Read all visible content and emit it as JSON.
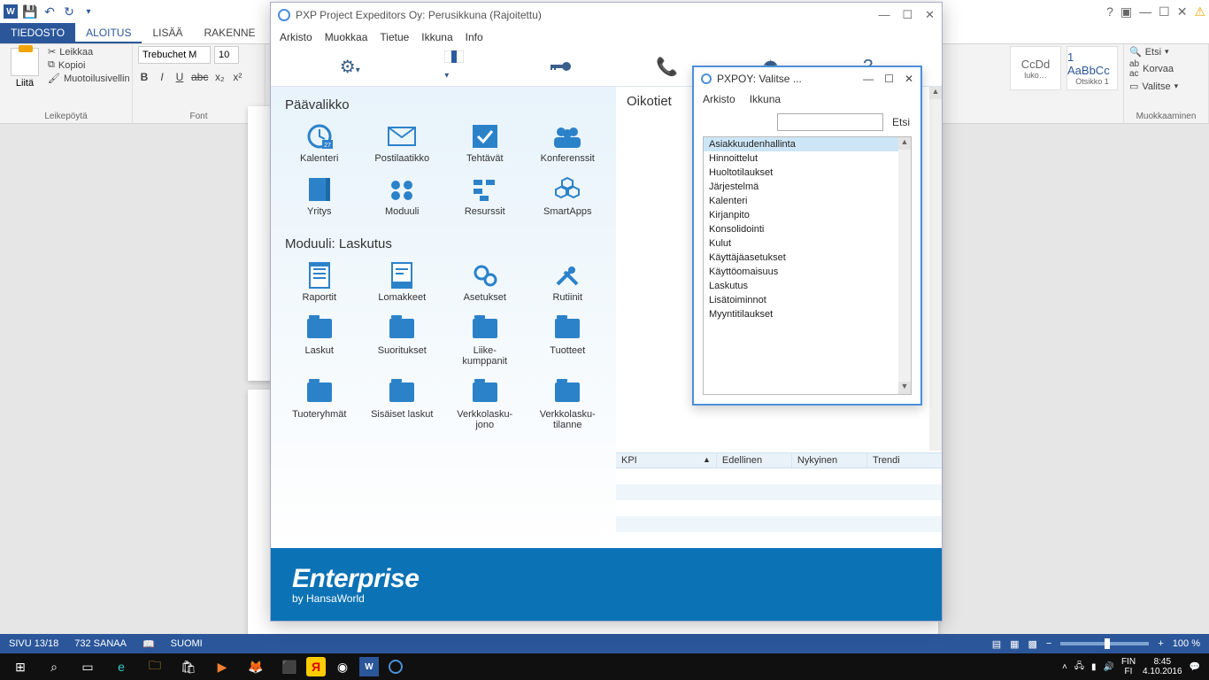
{
  "word": {
    "tabs": {
      "file": "TIEDOSTO",
      "home": "ALOITUS",
      "insert": "LISÄÄ",
      "layout": "RAKENNE"
    },
    "clipboard": {
      "paste": "Liitä",
      "cut": "Leikkaa",
      "copy": "Kopioi",
      "painter": "Muotoilusivellin",
      "label": "Leikepöytä"
    },
    "font": {
      "family": "Trebuchet M",
      "size": "10",
      "label": "Font"
    },
    "styles": {
      "s1": "CcDd",
      "s1n": "luko…",
      "s2": "1 AaBbCc",
      "s2n": "Otsikko 1"
    },
    "editing": {
      "find": "Etsi",
      "replace": "Korvaa",
      "select": "Valitse",
      "label": "Muokkaaminen"
    },
    "status": {
      "page": "SIVU 13/18",
      "words": "732 SANAA",
      "lang": "SUOMI",
      "zoom": "100 %"
    }
  },
  "pxp": {
    "title": "PXP Project Expeditors Oy: Perusikkuna (Rajoitettu)",
    "menu": [
      "Arkisto",
      "Muokkaa",
      "Tietue",
      "Ikkuna",
      "Info"
    ],
    "sections": {
      "main": "Päävalikko",
      "module": "Moduuli:  Laskutus",
      "shortcuts": "Oikotiet"
    },
    "tiles_main": [
      {
        "label": "Kalenteri",
        "icon": "calendar"
      },
      {
        "label": "Postilaatikko",
        "icon": "mail"
      },
      {
        "label": "Tehtävät",
        "icon": "check"
      },
      {
        "label": "Konferenssit",
        "icon": "people"
      },
      {
        "label": "Yritys",
        "icon": "book"
      },
      {
        "label": "Moduuli",
        "icon": "modules"
      },
      {
        "label": "Resurssit",
        "icon": "resources"
      },
      {
        "label": "SmartApps",
        "icon": "hex"
      }
    ],
    "tiles_module": [
      {
        "label": "Raportit",
        "icon": "report"
      },
      {
        "label": "Lomakkeet",
        "icon": "form"
      },
      {
        "label": "Asetukset",
        "icon": "gears"
      },
      {
        "label": "Rutiinit",
        "icon": "tools"
      },
      {
        "label": "Laskut",
        "icon": "folder"
      },
      {
        "label": "Suoritukset",
        "icon": "folder"
      },
      {
        "label": "Liike-kumppanit",
        "icon": "folder"
      },
      {
        "label": "Tuotteet",
        "icon": "folder"
      },
      {
        "label": "Tuoteryhmät",
        "icon": "folder"
      },
      {
        "label": "Sisäiset laskut",
        "icon": "folder"
      },
      {
        "label": "Verkkolasku-jono",
        "icon": "folder"
      },
      {
        "label": "Verkkolasku-tilanne",
        "icon": "folder"
      }
    ],
    "kpi": {
      "cols": [
        "KPI",
        "Edellinen",
        "Nykyinen",
        "Trendi"
      ]
    },
    "brand": "Enterprise",
    "brand_sub": "by HansaWorld"
  },
  "popup": {
    "title": "PXPOY: Valitse ...",
    "menu": [
      "Arkisto",
      "Ikkuna"
    ],
    "search_btn": "Etsi",
    "items": [
      "Asiakkuudenhallinta",
      "Hinnoittelut",
      "Huoltotilaukset",
      "Järjestelmä",
      "Kalenteri",
      "Kirjanpito",
      "Konsolidointi",
      "Kulut",
      "Käyttäjäasetukset",
      "Käyttöomaisuus",
      "Laskutus",
      "Lisätoiminnot",
      "Myyntitilaukset"
    ]
  },
  "taskbar": {
    "lang1": "FIN",
    "lang2": "FI",
    "time": "8:45",
    "date": "4.10.2016"
  }
}
